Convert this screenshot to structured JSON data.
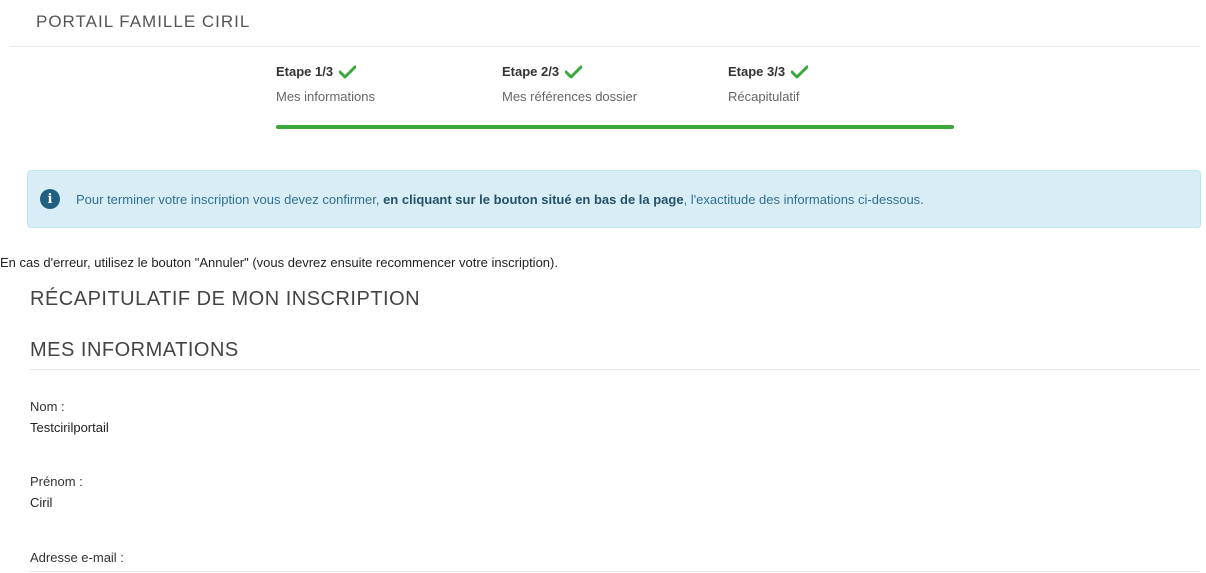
{
  "header": {
    "title": "PORTAIL FAMILLE CIRIL"
  },
  "steps": [
    {
      "title": "Etape 1/3",
      "subtitle": "Mes informations",
      "icon": "check-icon",
      "done": true
    },
    {
      "title": "Etape 2/3",
      "subtitle": "Mes références dossier",
      "icon": "check-icon",
      "done": true
    },
    {
      "title": "Etape 3/3",
      "subtitle": "Récapitulatif",
      "icon": "check-icon",
      "done": true
    }
  ],
  "progress": {
    "fraction": 1.0,
    "color": "#3aa83a"
  },
  "alert": {
    "icon": "info-icon",
    "text_before": "Pour terminer votre inscription vous devez confirmer, ",
    "text_bold": "en cliquant sur le bouton situé en bas de la page",
    "text_after": ", l'exactitude des informations ci-dessous."
  },
  "error_note": "En cas d'erreur, utilisez le bouton \"Annuler\" (vous devrez ensuite recommencer votre inscription).",
  "sections": {
    "recap_title": "RÉCAPITULATIF DE MON INSCRIPTION",
    "infos_title": "MES INFORMATIONS"
  },
  "fields": [
    {
      "label": "Nom :",
      "value": "Testcirilportail"
    },
    {
      "label": "Prénom :",
      "value": "Ciril"
    },
    {
      "label": "Adresse e-mail :",
      "value": ""
    }
  ],
  "colors": {
    "accent": "#3aa83a",
    "alert_bg": "#d9edf7",
    "alert_text": "#31708f"
  }
}
